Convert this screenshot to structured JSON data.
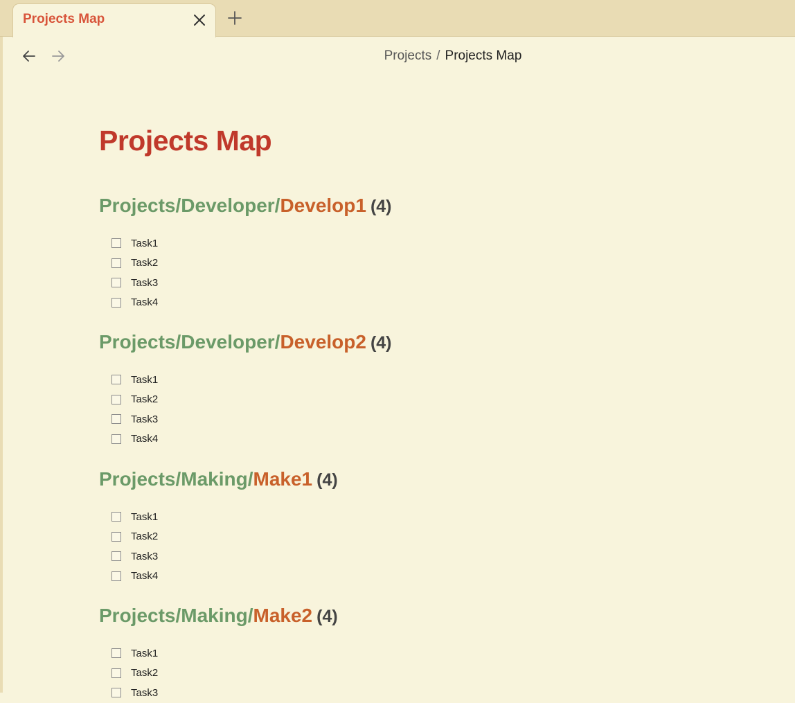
{
  "tab": {
    "title": "Projects Map"
  },
  "breadcrumb": {
    "parent": "Projects",
    "separator": "/",
    "current": "Projects Map"
  },
  "page": {
    "title": "Projects Map"
  },
  "sections": [
    {
      "prefix": "Projects/Developer/",
      "leaf": "Develop1",
      "count": "(4)",
      "tasks": [
        "Task1",
        "Task2",
        "Task3",
        "Task4"
      ]
    },
    {
      "prefix": "Projects/Developer/",
      "leaf": "Develop2",
      "count": "(4)",
      "tasks": [
        "Task1",
        "Task2",
        "Task3",
        "Task4"
      ]
    },
    {
      "prefix": "Projects/Making/",
      "leaf": "Make1",
      "count": "(4)",
      "tasks": [
        "Task1",
        "Task2",
        "Task3",
        "Task4"
      ]
    },
    {
      "prefix": "Projects/Making/",
      "leaf": "Make2",
      "count": "(4)",
      "tasks": [
        "Task1",
        "Task2",
        "Task3"
      ]
    }
  ],
  "icons": {
    "close": "close-icon",
    "new_tab": "plus-icon",
    "back": "arrow-left-icon",
    "forward": "arrow-right-icon",
    "checkbox": "checkbox-icon"
  },
  "colors": {
    "background": "#f8f4dc",
    "tab_bar": "#e9dcb4",
    "title": "#c0392b",
    "tab_title": "#d8543a",
    "path_prefix": "#6b9a68",
    "path_leaf": "#c8602a"
  }
}
